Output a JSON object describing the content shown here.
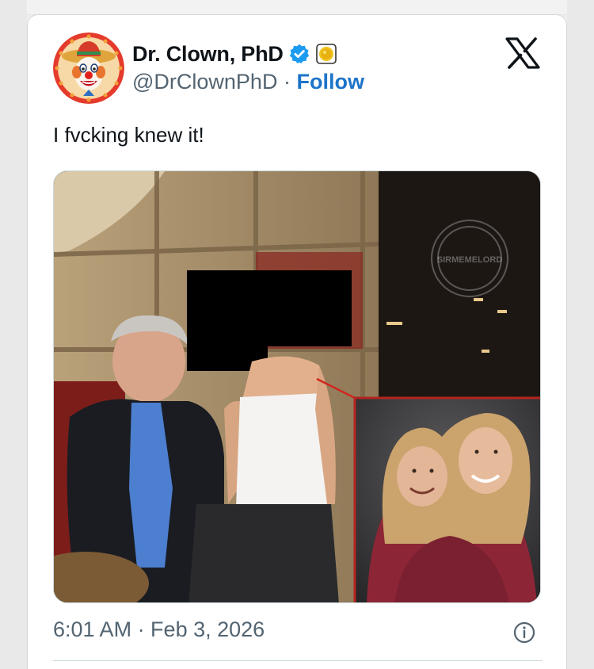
{
  "author": {
    "display_name": "Dr. Clown, PhD",
    "handle": "@DrClownPhD",
    "separator": "·",
    "follow_label": "Follow",
    "avatar_icon": "clown-avatar",
    "verified_icon": "verified-badge-icon",
    "verified_color": "#1d9bf0",
    "affiliation_icon": "gold-coin-badge-icon",
    "affiliation_color": "#f0c420"
  },
  "tweet": {
    "text": "I fvcking knew it!",
    "timestamp": "6:01 AM · Feb 3, 2026"
  },
  "media": {
    "watermark_text": "SIRMEMELORD",
    "description_icon": "tweet-photo"
  },
  "icons": {
    "platform_logo": "x-logo-icon",
    "info": "info-icon"
  },
  "colors": {
    "link": "#1d74c9",
    "secondary_text": "#536471",
    "primary_text": "#0f1419",
    "border": "#cfd9de"
  }
}
